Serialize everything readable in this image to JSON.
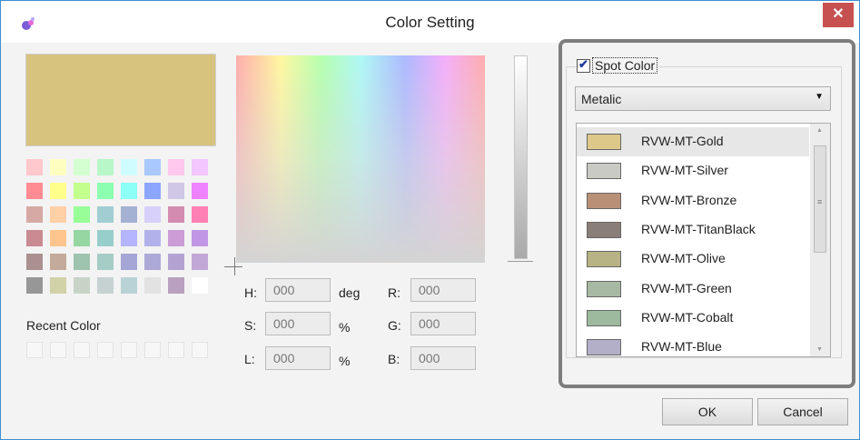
{
  "window": {
    "title": "Color Setting",
    "close_glyph": "✕",
    "app_icon": "color-palette-icon"
  },
  "preview_color": "#d7c37e",
  "palette": [
    "#ffc8cc",
    "#fdffc1",
    "#d4ffd0",
    "#b7f7c8",
    "#cffcff",
    "#a8c8ff",
    "#ffc8ec",
    "#f3c6ff",
    "#ff8c92",
    "#ffff8c",
    "#c2ff8c",
    "#8cffb0",
    "#8cfff7",
    "#8ca5ff",
    "#d0c6e6",
    "#ee82ff",
    "#d6a9a4",
    "#ffcfa6",
    "#98ff98",
    "#a0ced3",
    "#a5b1d3",
    "#d7d0fa",
    "#d38cb0",
    "#ff80b4",
    "#c98a92",
    "#ffc58d",
    "#96d6a3",
    "#97cecc",
    "#b4b4ff",
    "#b2b2ea",
    "#cc9cd6",
    "#c196e6",
    "#aa9090",
    "#c3aa9a",
    "#9ec3ae",
    "#a5ccc5",
    "#a5a5d6",
    "#aca9d6",
    "#b3a3d3",
    "#c1a7d6",
    "#979797",
    "#d2d2a8",
    "#c8d3c8",
    "#c6d2d2",
    "#b9d2d6",
    "#e2e2e2",
    "#b9a0c0",
    "#ffffff"
  ],
  "recent_label": "Recent Color",
  "recent_slots": 8,
  "fields": {
    "h": {
      "label": "H:",
      "value": "000",
      "unit": "deg"
    },
    "s": {
      "label": "S:",
      "value": "000",
      "unit": "%"
    },
    "l": {
      "label": "L:",
      "value": "000",
      "unit": "%"
    },
    "r": {
      "label": "R:",
      "value": "000"
    },
    "g": {
      "label": "G:",
      "value": "000"
    },
    "b": {
      "label": "B:",
      "value": "000"
    }
  },
  "spot": {
    "label": "Spot Color",
    "checked": true,
    "check_glyph": "✔",
    "category": "Metalic",
    "dropdown_arrow": "▼",
    "items": [
      {
        "name": "RVW-MT-Gold",
        "color": "#ddc88a",
        "selected": true
      },
      {
        "name": "RVW-MT-Silver",
        "color": "#c9cac3",
        "selected": false
      },
      {
        "name": "RVW-MT-Bronze",
        "color": "#b99076",
        "selected": false
      },
      {
        "name": "RVW-MT-TitanBlack",
        "color": "#8a7e78",
        "selected": false
      },
      {
        "name": "RVW-MT-Olive",
        "color": "#b8b384",
        "selected": false
      },
      {
        "name": "RVW-MT-Green",
        "color": "#a7b9a2",
        "selected": false
      },
      {
        "name": "RVW-MT-Cobalt",
        "color": "#9dba9f",
        "selected": false
      },
      {
        "name": "RVW-MT-Blue",
        "color": "#b3afc9",
        "selected": false
      }
    ],
    "scroll_up": "▲",
    "scroll_down": "▼",
    "scroll_grip": "≡"
  },
  "buttons": {
    "ok": "OK",
    "cancel": "Cancel"
  }
}
